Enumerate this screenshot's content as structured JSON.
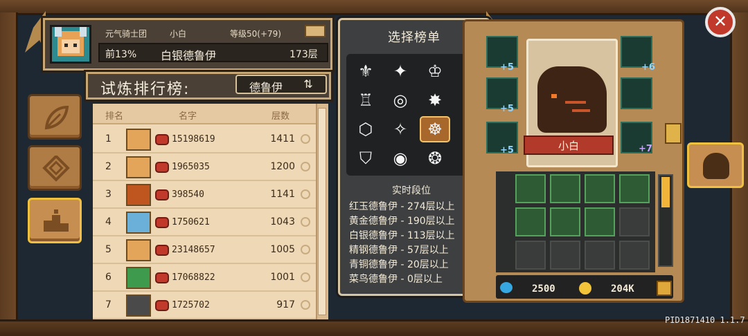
{
  "player": {
    "guild": "元气骑士团",
    "name": "小白",
    "level": "等级50(+79)",
    "rank_percent": "前13%",
    "title": "白银德鲁伊",
    "floor": "173层"
  },
  "leaderboard": {
    "title": "试炼排行榜:",
    "class_label": "德鲁伊",
    "swap_icon": "⇅",
    "columns": [
      "排名",
      "名字",
      "层数"
    ],
    "rows": [
      {
        "rank": "1",
        "name": "15198619",
        "floor": "1411",
        "avatar_color": "#e2a55a"
      },
      {
        "rank": "2",
        "name": "1965035",
        "floor": "1200",
        "avatar_color": "#e2a55a"
      },
      {
        "rank": "3",
        "name": "398540",
        "floor": "1141",
        "avatar_color": "#c0561f"
      },
      {
        "rank": "4",
        "name": "1750621",
        "floor": "1043",
        "avatar_color": "#6ab0d8"
      },
      {
        "rank": "5",
        "name": "23148657",
        "floor": "1005",
        "avatar_color": "#e2a55a"
      },
      {
        "rank": "6",
        "name": "17068822",
        "floor": "1001",
        "avatar_color": "#3e9a4c"
      },
      {
        "rank": "7",
        "name": "1725702",
        "floor": "917",
        "avatar_color": "#4a4a4a"
      }
    ]
  },
  "select_panel": {
    "title": "选择榜单",
    "icons": [
      {
        "name": "hero-class-icon-1",
        "glyph": "⚜",
        "selected": false
      },
      {
        "name": "hero-class-icon-2",
        "glyph": "✦",
        "selected": false
      },
      {
        "name": "hero-class-icon-3",
        "glyph": "♔",
        "selected": false
      },
      {
        "name": "hero-class-icon-4",
        "glyph": "♜",
        "selected": false
      },
      {
        "name": "hero-class-icon-5",
        "glyph": "♖",
        "selected": false
      },
      {
        "name": "hero-class-icon-6",
        "glyph": "◎",
        "selected": false
      },
      {
        "name": "hero-class-icon-7",
        "glyph": "✸",
        "selected": false
      },
      {
        "name": "hero-class-icon-8",
        "glyph": "⚔",
        "selected": false
      },
      {
        "name": "hero-class-icon-9",
        "glyph": "⬡",
        "selected": false
      },
      {
        "name": "hero-class-icon-10",
        "glyph": "✧",
        "selected": false
      },
      {
        "name": "hero-class-icon-11",
        "glyph": "☸",
        "selected": true
      },
      {
        "name": "hero-class-icon-12",
        "glyph": "♨",
        "selected": false
      },
      {
        "name": "hero-class-icon-13",
        "glyph": "⛉",
        "selected": false
      },
      {
        "name": "hero-class-icon-14",
        "glyph": "◉",
        "selected": false
      },
      {
        "name": "hero-class-icon-15",
        "glyph": "❂",
        "selected": false
      },
      {
        "name": "hero-class-icon-16",
        "glyph": "⊛",
        "selected": false
      }
    ],
    "live_title": "实时段位",
    "help_glyph": "?",
    "tiers": [
      "红玉德鲁伊 - 274层以上",
      "黄金德鲁伊 - 190层以上",
      "白银德鲁伊 - 113层以上",
      "精钢德鲁伊 - 57层以上",
      "青铜德鲁伊 - 20层以上",
      "菜鸟德鲁伊 - 0层以上"
    ]
  },
  "pet_panel": {
    "pet_name": "小白",
    "left_badges": [
      "+5",
      "+5",
      "+5"
    ],
    "right_badges": [
      "+6",
      "",
      "+7"
    ]
  },
  "resources": {
    "gems": "2500",
    "coins": "204K"
  },
  "close_label": "✕",
  "version": "PID1871410 1.1.7"
}
